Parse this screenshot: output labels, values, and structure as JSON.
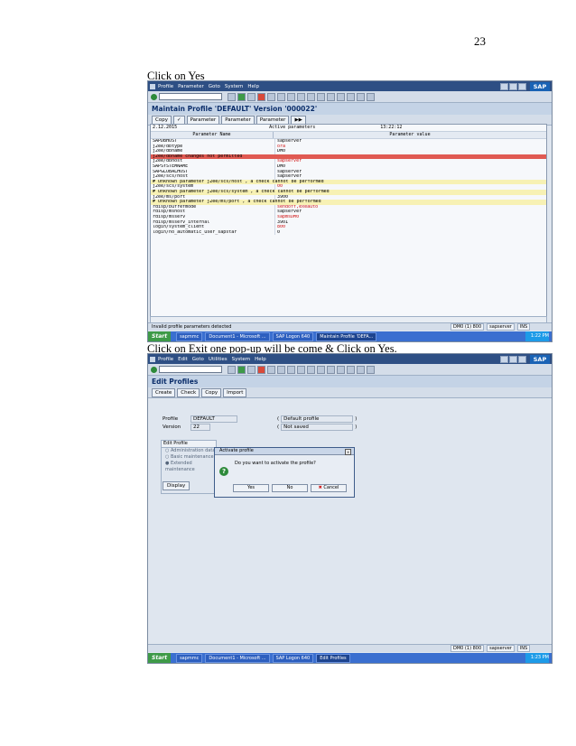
{
  "page_number": "23",
  "caption1": "Click on Yes",
  "caption2": "Click on Exit one pop-up will be come & Click on Yes.",
  "sap_logo": "SAP",
  "shot1": {
    "menu": [
      "Profile",
      "Parameter",
      "Goto",
      "System",
      "Help"
    ],
    "title": "Maintain Profile 'DEFAULT' Version '000022'",
    "app_buttons": [
      "Copy",
      "Parameter",
      "Parameter",
      "Parameter"
    ],
    "header_date": "2.12.2015",
    "header_center": "Active parameters",
    "header_time": "13:22:12",
    "col1": "Parameter Name",
    "col2": "Parameter value",
    "rows": [
      {
        "name": "SAPDBHOST",
        "value": "sapserver",
        "style": "",
        "red": false
      },
      {
        "name": "j2ee/dbtype",
        "value": "ora",
        "style": "",
        "red": true
      },
      {
        "name": "j2ee/dbname",
        "value": "DM0",
        "style": "",
        "red": false
      },
      {
        "name": "j2ee/dbname changes not permitted",
        "value": "",
        "style": "err",
        "red": false
      },
      {
        "name": "j2ee/dbhost",
        "value": "sapserver",
        "style": "",
        "red": true
      },
      {
        "name": "SAPSYSTEMNAME",
        "value": "DM0",
        "style": "",
        "red": false
      },
      {
        "name": "SAPGLOBALHOST",
        "value": "sapserver",
        "style": "",
        "red": false
      },
      {
        "name": "j2ee/scs/host",
        "value": "sapserver",
        "style": "",
        "red": false
      },
      {
        "name": "# Unknown parameter j2ee/scs/host , a check cannot be performed",
        "value": "",
        "style": "warn",
        "red": false
      },
      {
        "name": "j2ee/scs/system",
        "value": "00",
        "style": "",
        "red": true
      },
      {
        "name": "# Unknown parameter j2ee/scs/system , a check cannot be performed",
        "value": "",
        "style": "warn",
        "red": false
      },
      {
        "name": "j2ee/ms/port",
        "value": "3900",
        "style": "",
        "red": false
      },
      {
        "name": "# Unknown parameter j2ee/ms/port , a check cannot be performed",
        "value": "",
        "style": "warn",
        "red": false
      },
      {
        "name": "rdisp/bufrefmode",
        "value": "sendoff,exeauto",
        "style": "",
        "red": true
      },
      {
        "name": "rdisp/mshost",
        "value": "sapserver",
        "style": "",
        "red": false
      },
      {
        "name": "rdisp/msserv",
        "value": "sapmsDM0",
        "style": "",
        "red": true
      },
      {
        "name": "rdisp/msserv_internal",
        "value": "3901",
        "style": "",
        "red": false
      },
      {
        "name": "login/system_client",
        "value": "800",
        "style": "",
        "red": true
      },
      {
        "name": "login/no_automatic_user_sapstar",
        "value": "0",
        "style": "",
        "red": false
      }
    ],
    "status_msg": "Invalid profile parameters detected",
    "status_sys": [
      "DM0 (1) 800",
      "sapserver",
      "INS"
    ],
    "taskbar": [
      "sapmmc",
      "Document1 - Microsoft ...",
      "SAP Logon 640",
      "Maintain Profile 'DEFA..."
    ],
    "clock": "1:22 PM"
  },
  "shot2": {
    "menu": [
      "Profile",
      "Edit",
      "Goto",
      "Utilities",
      "System",
      "Help"
    ],
    "title": "Edit Profiles",
    "app_buttons": [
      "Create",
      "Check",
      "Copy",
      "Import"
    ],
    "profile_label": "Profile",
    "profile_value": "DEFAULT",
    "profile_desc": "Default profile",
    "version_label": "Version",
    "version_value": "22",
    "version_desc": "Not saved",
    "editbox_title": "Edit Profile",
    "editbox_options": [
      "Administration data",
      "Basic maintenance",
      "Extended maintenance"
    ],
    "display_btn": "Display",
    "dialog_title": "Activate profile",
    "dialog_text": "Do you want to activate the profile?",
    "dialog_yes": "Yes",
    "dialog_no": "No",
    "dialog_cancel": "Cancel",
    "status_sys": [
      "DM0 (1) 800",
      "sapserver",
      "INS"
    ],
    "taskbar": [
      "sapmmc",
      "Document1 - Microsoft ...",
      "SAP Logon 640",
      "Edit Profiles"
    ],
    "clock": "1:23 PM"
  }
}
